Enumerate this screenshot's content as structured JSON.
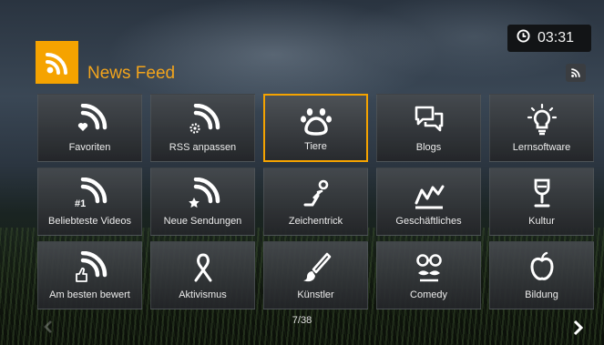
{
  "header": {
    "title": "News Feed",
    "logo_icon": "rss-icon",
    "accent_color": "#f5a300"
  },
  "status": {
    "time": "03:31",
    "clock_icon": "clock-icon"
  },
  "tiles": [
    {
      "label": "Favoriten",
      "icon": "rss-heart-icon"
    },
    {
      "label": "RSS anpassen",
      "icon": "rss-gear-icon"
    },
    {
      "label": "Tiere",
      "icon": "paw-icon"
    },
    {
      "label": "Blogs",
      "icon": "chat-bubbles-icon"
    },
    {
      "label": "Lernsoftware",
      "icon": "lightbulb-icon"
    },
    {
      "label": "Beliebteste Videos",
      "icon": "rss-top-icon"
    },
    {
      "label": "Neue Sendungen",
      "icon": "rss-star-icon"
    },
    {
      "label": "Zeichentrick",
      "icon": "jump-icon"
    },
    {
      "label": "Geschäftliches",
      "icon": "trend-chart-icon"
    },
    {
      "label": "Kultur",
      "icon": "goblet-icon"
    },
    {
      "label": "Am besten bewert",
      "icon": "rss-thumb-icon"
    },
    {
      "label": "Aktivismus",
      "icon": "ribbon-icon"
    },
    {
      "label": "Künstler",
      "icon": "brush-icon"
    },
    {
      "label": "Comedy",
      "icon": "glasses-mustache-icon"
    },
    {
      "label": "Bildung",
      "icon": "apple-icon"
    }
  ],
  "selected_tile": "Tiere",
  "pager": {
    "text": "7/38"
  }
}
